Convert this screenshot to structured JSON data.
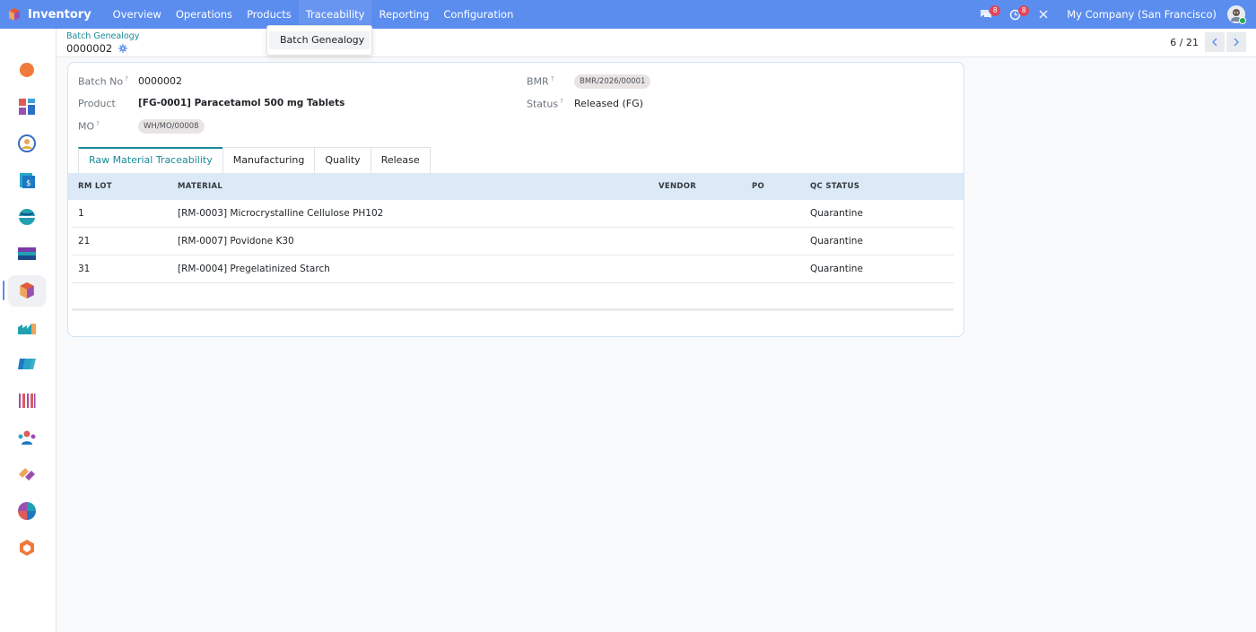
{
  "navbar": {
    "app_name": "Inventory",
    "menus": [
      "Overview",
      "Operations",
      "Products",
      "Traceability",
      "Reporting",
      "Configuration"
    ],
    "chat_badge": "8",
    "activity_badge": "8",
    "company": "My Company (San Francisco)"
  },
  "dropdown": {
    "items": [
      "Batch Genealogy"
    ]
  },
  "breadcrumb": {
    "parent": "Batch Genealogy",
    "current": "0000002"
  },
  "pager": {
    "text": "6 / 21"
  },
  "form": {
    "batch_no_label": "Batch No",
    "batch_no": "0000002",
    "product_label": "Product",
    "product": "[FG-0001] Paracetamol 500 mg Tablets",
    "mo_label": "MO",
    "mo": "WH/MO/00008",
    "bmr_label": "BMR",
    "bmr": "BMR/2026/00001",
    "status_label": "Status",
    "status": "Released (FG)",
    "help_mark": "?"
  },
  "tabs": [
    "Raw Material Traceability",
    "Manufacturing",
    "Quality",
    "Release"
  ],
  "table": {
    "headers": [
      "RM LOT",
      "MATERIAL",
      "VENDOR",
      "PO",
      "QC STATUS"
    ],
    "rows": [
      {
        "lot": "1",
        "material": "[RM-0003] Microcrystalline Cellulose PH102",
        "vendor": "",
        "po": "",
        "qc": "Quarantine"
      },
      {
        "lot": "21",
        "material": "[RM-0007] Povidone K30",
        "vendor": "",
        "po": "",
        "qc": "Quarantine"
      },
      {
        "lot": "31",
        "material": "[RM-0004] Pregelatinized Starch",
        "vendor": "",
        "po": "",
        "qc": "Quarantine"
      }
    ]
  },
  "colors": {
    "navbar": "#5b8def",
    "accent": "#1b8a9a",
    "table_header": "#dce9f7"
  },
  "sidebar_icons": [
    "discuss-icon",
    "dashboards-icon",
    "crm-icon",
    "invoicing-icon",
    "website-icon",
    "accounting-icon",
    "inventory-icon",
    "manufacturing-icon",
    "purchase-icon",
    "barcode-icon",
    "employees-icon",
    "sales-icon",
    "planning-icon",
    "apps-icon"
  ]
}
